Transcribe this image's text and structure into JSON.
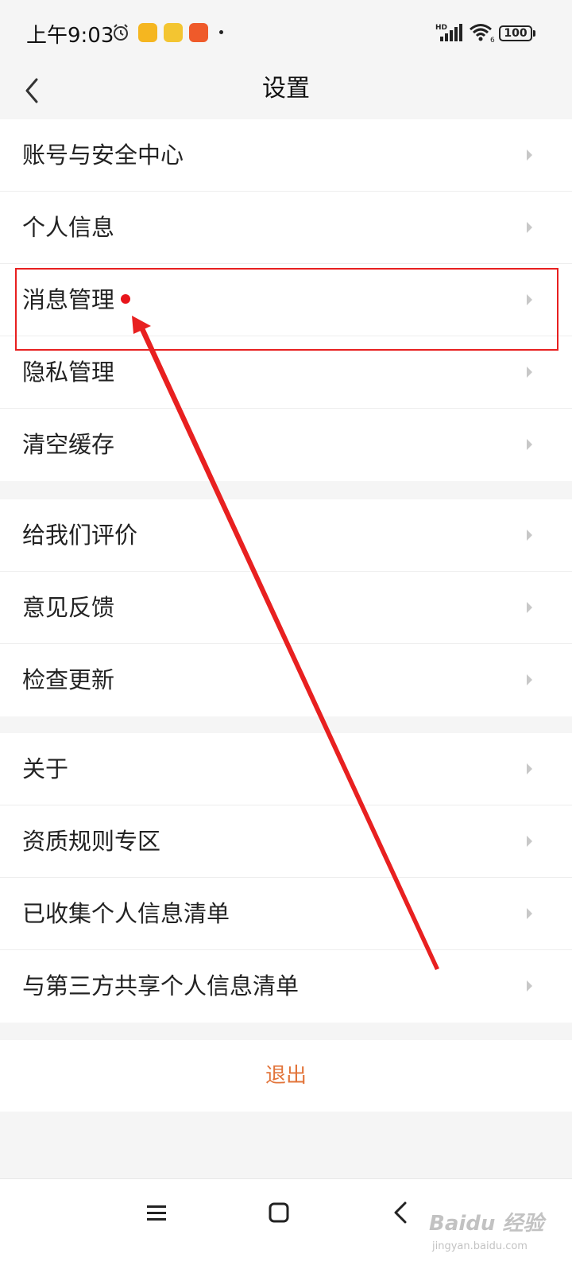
{
  "status_bar": {
    "time": "上午9:03",
    "network": "HD",
    "wifi_sub": "6",
    "battery": "100"
  },
  "header": {
    "title": "设置"
  },
  "groups": [
    {
      "items": [
        {
          "label": "账号与安全中心"
        },
        {
          "label": "个人信息"
        },
        {
          "label": "消息管理",
          "badge": "red-dot"
        },
        {
          "label": "隐私管理"
        },
        {
          "label": "清空缓存"
        }
      ]
    },
    {
      "items": [
        {
          "label": "给我们评价"
        },
        {
          "label": "意见反馈"
        },
        {
          "label": "检查更新"
        }
      ]
    },
    {
      "items": [
        {
          "label": "关于"
        },
        {
          "label": "资质规则专区"
        },
        {
          "label": "已收集个人信息清单"
        },
        {
          "label": "与第三方共享个人信息清单"
        }
      ]
    }
  ],
  "logout": {
    "label": "退出",
    "color": "#e2743a"
  },
  "colors": {
    "background": "#f5f5f5",
    "annotation": "#e82020",
    "badge": "#e8151b"
  },
  "watermark": {
    "text": "Baidu 经验",
    "sub": "jingyan.baidu.com"
  }
}
